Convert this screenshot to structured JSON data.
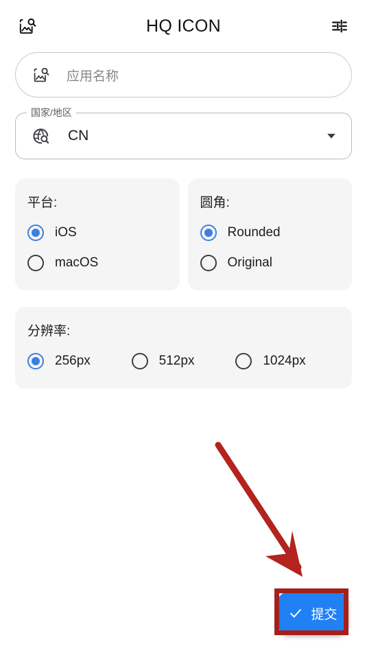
{
  "appbar": {
    "title": "HQ ICON",
    "left_icon": "image-search-icon",
    "right_icon": "tune-sliders-icon"
  },
  "search": {
    "placeholder": "应用名称",
    "icon": "image-search-icon",
    "value": ""
  },
  "country_select": {
    "label": "国家/地区",
    "value": "CN",
    "icon": "globe-search-icon",
    "arrow_icon": "chevron-down-icon"
  },
  "platform_card": {
    "title": "平台:",
    "options": [
      {
        "label": "iOS",
        "selected": true
      },
      {
        "label": "macOS",
        "selected": false
      }
    ]
  },
  "corner_card": {
    "title": "圆角:",
    "options": [
      {
        "label": "Rounded",
        "selected": true
      },
      {
        "label": "Original",
        "selected": false
      }
    ]
  },
  "resolution_card": {
    "title": "分辨率:",
    "options": [
      {
        "label": "256px",
        "selected": true
      },
      {
        "label": "512px",
        "selected": false
      },
      {
        "label": "1024px",
        "selected": false
      }
    ]
  },
  "submit_fab": {
    "label": "提交",
    "icon": "check-icon"
  },
  "annotations": {
    "arrow": "red-arrow-pointing-to-submit",
    "highlight": "red-rectangle-around-submit"
  },
  "colors": {
    "accent_blue": "#2081f5",
    "radio_blue": "#3b7fe0",
    "card_bg": "#f5f5f5",
    "annotation_red": "#a4201c",
    "placeholder_gray": "#86868b"
  }
}
